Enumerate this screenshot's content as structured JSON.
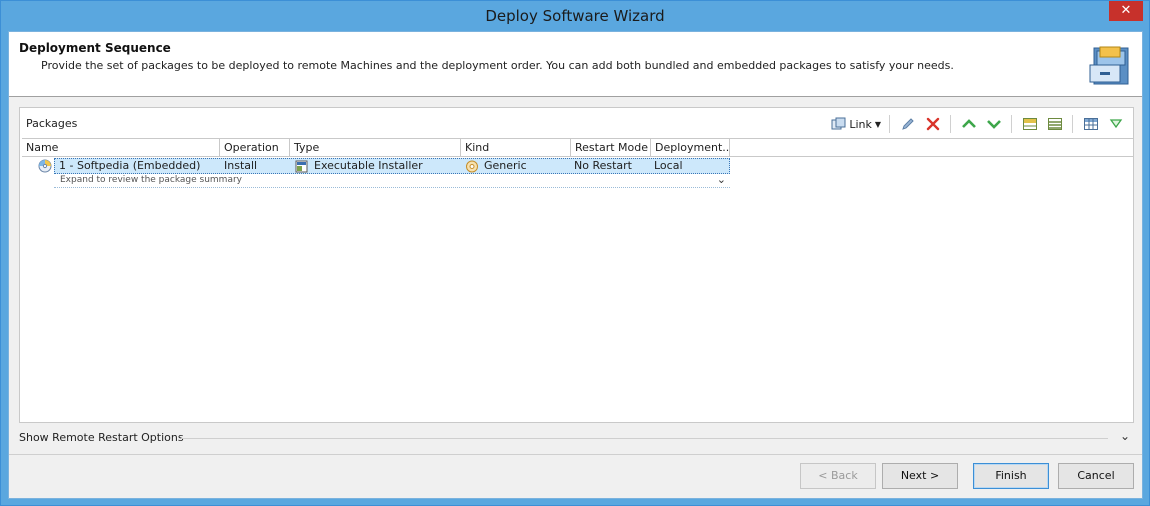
{
  "window": {
    "title": "Deploy Software Wizard",
    "close_glyph": "✕"
  },
  "header": {
    "title": "Deployment Sequence",
    "description": "Provide the set of packages to be deployed to remote Machines and the deployment order. You can add both bundled and embedded packages to satisfy your needs.",
    "icon": "cabinet-drawer-icon"
  },
  "packages": {
    "label": "Packages",
    "toolbar": {
      "link_label": "Link",
      "icons": [
        "link-icon",
        "edit-icon",
        "delete-icon",
        "move-up-icon",
        "move-down-icon",
        "expand-rows-icon",
        "collapse-rows-icon",
        "column-chooser-icon",
        "filter-icon"
      ]
    },
    "columns": [
      "Name",
      "Operation",
      "Type",
      "Kind",
      "Restart Mode",
      "Deployment..."
    ],
    "rows": [
      {
        "name": "1 - Softpedia (Embedded)",
        "operation": "Install",
        "type": "Executable Installer",
        "kind": "Generic",
        "restart_mode": "No Restart",
        "deployment": "Local",
        "summary": "Expand to review the package summary"
      }
    ]
  },
  "restart_options": {
    "label": "Show Remote Restart Options"
  },
  "footer": {
    "back_label": "< Back",
    "next_label": "Next >",
    "finish_label": "Finish",
    "cancel_label": "Cancel"
  },
  "colors": {
    "title_bar": "#5aa7df",
    "close_button": "#c7312b",
    "selection": "#cde8fb"
  }
}
